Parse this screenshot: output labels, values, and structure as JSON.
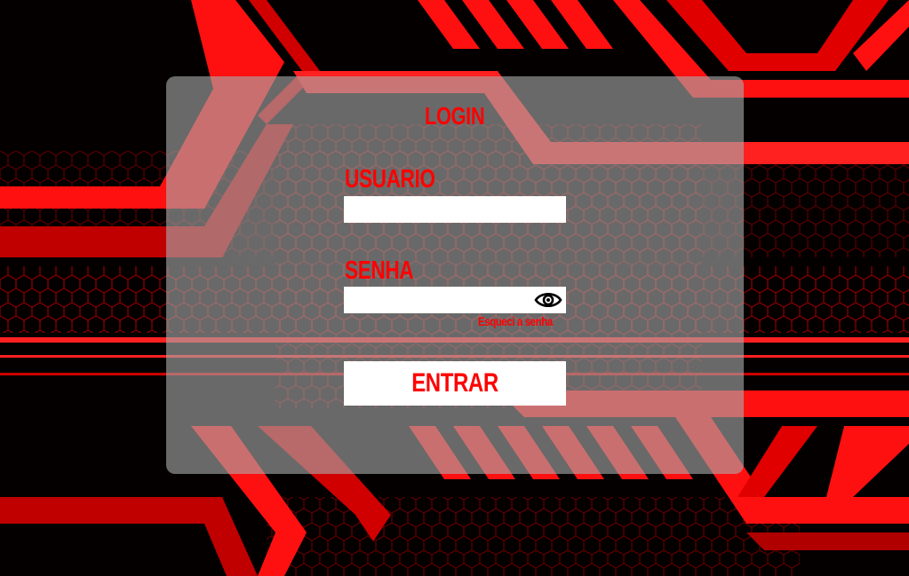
{
  "login": {
    "title": "LOGIN",
    "username_label": "USUARIO",
    "username_value": "",
    "password_label": "SENHA",
    "password_value": "",
    "forgot_label": "Esqueci a senha",
    "submit_label": "ENTRAR"
  },
  "colors": {
    "accent": "#ff0000",
    "panel": "#aaaaaa",
    "background": "#000000"
  },
  "icons": {
    "show_password": "eye-icon"
  }
}
